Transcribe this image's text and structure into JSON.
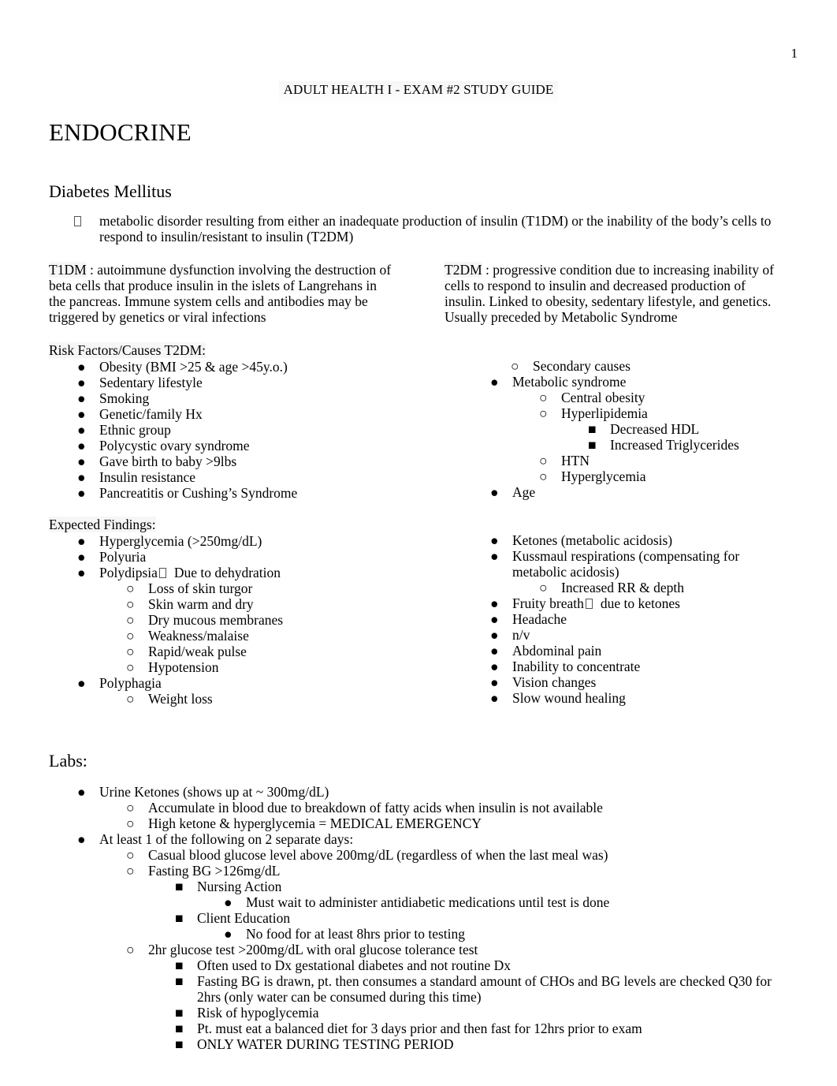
{
  "page": {
    "number": "1",
    "running_header": "ADULT HEALTH I - EXAM #2 STUDY GUIDE"
  },
  "document": {
    "title": "ENDOCRINE",
    "section_heading": "Diabetes Mellitus",
    "intro_bullet": "metabolic disorder resulting from either an inadequate production of insulin (T1DM) or the inability of the body’s cells to respond to insulin/resistant to insulin (T2DM)",
    "definitions": {
      "t1dm_label": "T1DM",
      "t1dm_text": " : autoimmune dysfunction involving the destruction of beta cells that produce insulin in the islets of Langrehans in the pancreas. Immune system cells and antibodies may be triggered by genetics or viral infections",
      "t2dm_label": "T2DM",
      "t2dm_text": " : progressive condition due to increasing inability of cells to respond to insulin and decreased production of insulin. Linked to obesity, sedentary lifestyle, and genetics. Usually preceded by Metabolic Syndrome"
    },
    "risk_factors": {
      "label": "Risk Factors/Causes T2DM:",
      "left_items": [
        "Obesity (BMI >25 & age >45y.o.)",
        "Sedentary lifestyle",
        "Smoking",
        "Genetic/family Hx",
        "Ethnic group",
        "Polycystic ovary syndrome",
        "Gave birth to baby >9lbs",
        "Insulin resistance",
        "Pancreatitis or Cushing’s Syndrome"
      ],
      "right_items": {
        "secondary_causes": "Secondary causes",
        "metabolic_syndrome": "Metabolic syndrome",
        "central_obesity": "Central obesity",
        "hyperlipidemia": "Hyperlipidemia",
        "decreased_hdl": "Decreased HDL",
        "increased_triglycerides": "Increased Triglycerides",
        "htn": "HTN",
        "hyperglycemia": "Hyperglycemia",
        "age": "Age"
      }
    },
    "expected_findings": {
      "label": "Expected Findings:",
      "left": {
        "hyperglycemia": "Hyperglycemia (>250mg/dL)",
        "polyuria": "Polyuria",
        "polydipsia": "Polydipsia",
        "polydipsia_cause": "Due to dehydration",
        "sub_items": [
          "Loss of skin turgor",
          "Skin warm and dry",
          "Dry mucous membranes",
          "Weakness/malaise",
          "Rapid/weak pulse",
          "Hypotension"
        ],
        "polyphagia": "Polyphagia",
        "weight_loss": "Weight loss"
      },
      "right": {
        "ketones": "Ketones (metabolic acidosis)",
        "kussmaul": "Kussmaul respirations (compensating for metabolic acidosis)",
        "increased_rr": "Increased RR & depth",
        "fruity_breath": "Fruity breath",
        "fruity_breath_cause": "due to ketones",
        "tail_items": [
          "Headache",
          "n/v",
          "Abdominal pain",
          "Inability to concentrate",
          "Vision changes",
          "Slow wound healing"
        ]
      }
    },
    "labs": {
      "heading": "Labs:",
      "urine_ketones": "Urine Ketones (shows up at ~ 300mg/dL)",
      "urine_ketones_subs": [
        "Accumulate in blood due to breakdown of fatty acids when insulin is not available",
        "High ketone & hyperglycemia = MEDICAL EMERGENCY"
      ],
      "at_least_one": "At least 1 of the following on 2 separate days:",
      "casual_bg": "Casual blood glucose level above 200mg/dL (regardless of when the last meal was)",
      "fasting_bg": "Fasting BG >126mg/dL",
      "nursing_action": "Nursing Action",
      "nursing_action_sub": "Must wait to administer antidiabetic medications until test is done",
      "client_education": "Client Education",
      "client_education_sub": "No food for at least 8hrs prior to testing",
      "two_hour_test": "2hr glucose test >200mg/dL with oral glucose tolerance test",
      "two_hour_subs": [
        "Often used to Dx gestational diabetes and not routine Dx",
        "Fasting BG is drawn, pt. then consumes a standard amount of CHOs and BG levels are checked Q30 for 2hrs (only water can be consumed during this time)",
        "Risk of hypoglycemia",
        "Pt. must eat a balanced diet for 3 days prior and then fast for 12hrs prior to exam"
      ],
      "only_water": "ONLY WATER DURING TESTING PERIOD"
    },
    "markers": {
      "disc": "●",
      "circle": "○",
      "square": "■"
    }
  }
}
